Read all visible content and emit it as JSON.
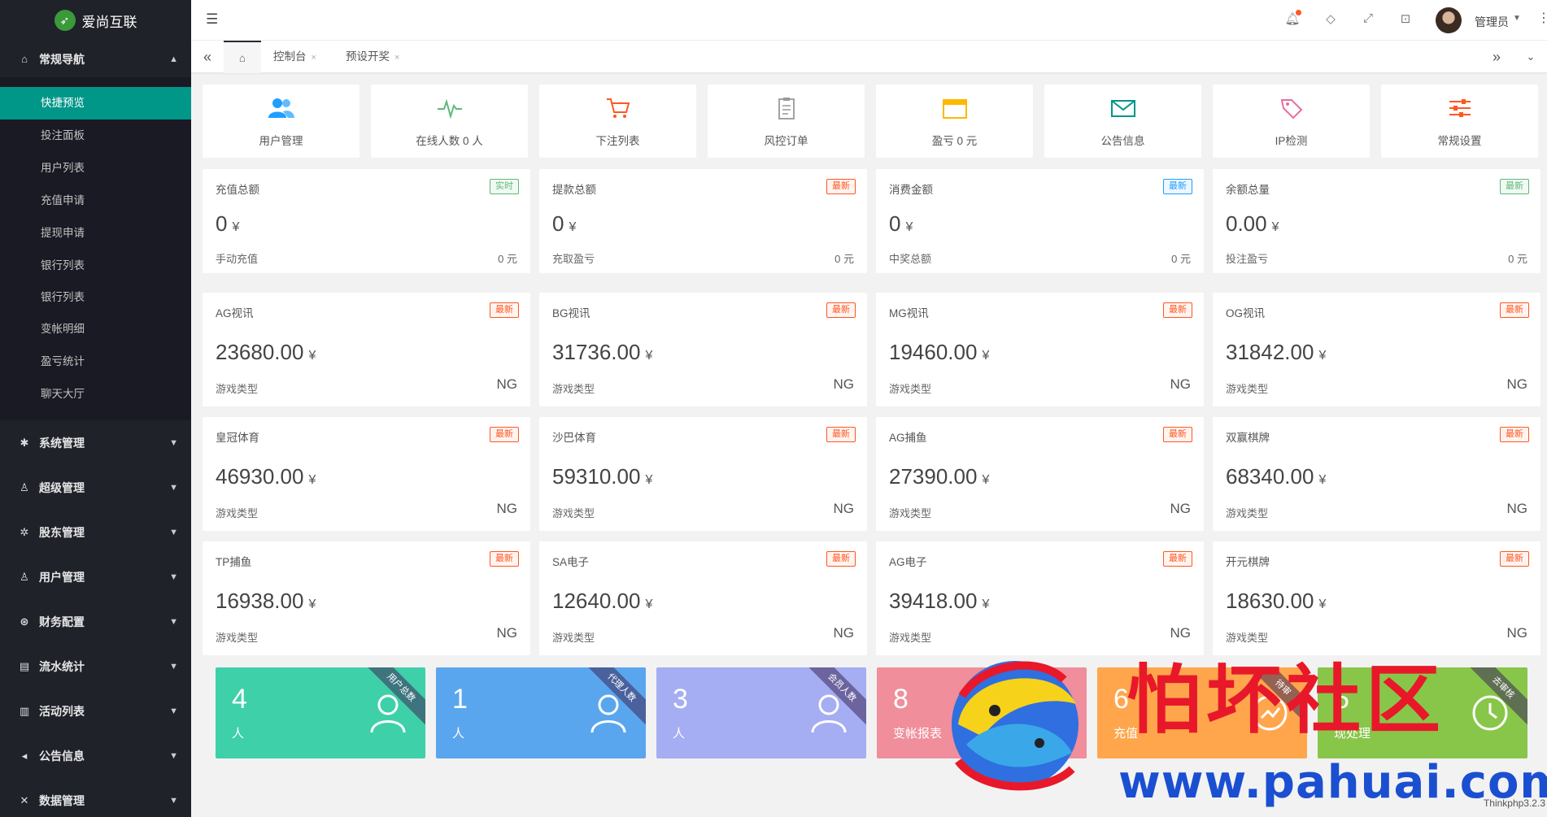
{
  "app": {
    "name": "爱尚互联",
    "version": "Thinkphp3.2.3",
    "colors": {
      "sidebar": "#20222a",
      "accent": "#009688"
    }
  },
  "sidebar": {
    "groups": [
      {
        "label": "常规导航",
        "icon": "home-icon",
        "expanded": true,
        "items": [
          "快捷预览",
          "投注面板",
          "用户列表",
          "充值申请",
          "提现申请",
          "银行列表",
          "银行列表",
          "变帐明细",
          "盈亏统计",
          "聊天大厅"
        ]
      },
      {
        "label": "系统管理",
        "icon": "gear-icon"
      },
      {
        "label": "超级管理",
        "icon": "user-icon"
      },
      {
        "label": "股东管理",
        "icon": "settings-icon"
      },
      {
        "label": "用户管理",
        "icon": "users-icon"
      },
      {
        "label": "财务配置",
        "icon": "yen-icon"
      },
      {
        "label": "流水统计",
        "icon": "list-icon"
      },
      {
        "label": "活动列表",
        "icon": "gift-icon"
      },
      {
        "label": "公告信息",
        "icon": "speaker-icon"
      },
      {
        "label": "数据管理",
        "icon": "tools-icon"
      }
    ]
  },
  "header": {
    "user_name": "管理员"
  },
  "tabs": {
    "items": [
      {
        "label": "控制台",
        "close": "×"
      },
      {
        "label": "预设开奖",
        "close": "×"
      }
    ]
  },
  "quick_links": [
    {
      "label": "用户管理",
      "icon": "users-icon",
      "color": "#1E9FFF"
    },
    {
      "label": "在线人数 0 人",
      "icon": "pulse-icon",
      "color": "#5FB878"
    },
    {
      "label": "下注列表",
      "icon": "cart-icon",
      "color": "#FF5722"
    },
    {
      "label": "风控订单",
      "icon": "clipboard-icon",
      "color": "#999999"
    },
    {
      "label": "盈亏 0 元",
      "icon": "wallet-icon",
      "color": "#FFB800"
    },
    {
      "label": "公告信息",
      "icon": "mail-icon",
      "color": "#009688"
    },
    {
      "label": "IP检测",
      "icon": "tag-icon",
      "color": "#E86CA3"
    },
    {
      "label": "常规设置",
      "icon": "sliders-icon",
      "color": "#FF5722"
    }
  ],
  "summary_cards": [
    {
      "title": "充值总额",
      "badge": "实时",
      "badge_type": "green",
      "value": "0",
      "currency": "¥",
      "foot": "手动充值",
      "right": "0 元"
    },
    {
      "title": "提款总额",
      "badge": "最新",
      "badge_type": "red",
      "value": "0",
      "currency": "¥",
      "foot": "充取盈亏",
      "right": "0 元"
    },
    {
      "title": "消费金额",
      "badge": "最新",
      "badge_type": "blue",
      "value": "0",
      "currency": "¥",
      "foot": "中奖总额",
      "right": "0 元"
    },
    {
      "title": "余额总量",
      "badge": "最新",
      "badge_type": "green",
      "value": "0.00",
      "currency": "¥",
      "foot": "投注盈亏",
      "right": "0 元"
    }
  ],
  "game_cards": [
    {
      "title": "AG视讯",
      "badge": "最新",
      "value": "23680.00",
      "currency": "¥",
      "foot": "游戏类型",
      "right": "NG"
    },
    {
      "title": "BG视讯",
      "badge": "最新",
      "value": "31736.00",
      "currency": "¥",
      "foot": "游戏类型",
      "right": "NG"
    },
    {
      "title": "MG视讯",
      "badge": "最新",
      "value": "19460.00",
      "currency": "¥",
      "foot": "游戏类型",
      "right": "NG"
    },
    {
      "title": "OG视讯",
      "badge": "最新",
      "value": "31842.00",
      "currency": "¥",
      "foot": "游戏类型",
      "right": "NG"
    },
    {
      "title": "皇冠体育",
      "badge": "最新",
      "value": "46930.00",
      "currency": "¥",
      "foot": "游戏类型",
      "right": "NG"
    },
    {
      "title": "沙巴体育",
      "badge": "最新",
      "value": "59310.00",
      "currency": "¥",
      "foot": "游戏类型",
      "right": "NG"
    },
    {
      "title": "AG捕鱼",
      "badge": "最新",
      "value": "27390.00",
      "currency": "¥",
      "foot": "游戏类型",
      "right": "NG"
    },
    {
      "title": "双赢棋牌",
      "badge": "最新",
      "value": "68340.00",
      "currency": "¥",
      "foot": "游戏类型",
      "right": "NG"
    },
    {
      "title": "TP捕鱼",
      "badge": "最新",
      "value": "16938.00",
      "currency": "¥",
      "foot": "游戏类型",
      "right": "NG"
    },
    {
      "title": "SA电子",
      "badge": "最新",
      "value": "12640.00",
      "currency": "¥",
      "foot": "游戏类型",
      "right": "NG"
    },
    {
      "title": "AG电子",
      "badge": "最新",
      "value": "39418.00",
      "currency": "¥",
      "foot": "游戏类型",
      "right": "NG"
    },
    {
      "title": "开元棋牌",
      "badge": "最新",
      "value": "18630.00",
      "currency": "¥",
      "foot": "游戏类型",
      "right": "NG"
    }
  ],
  "stat_tiles": [
    {
      "number": "4",
      "unit": "人",
      "ribbon": "用户总数",
      "color": "#3ED0A9",
      "icon": "user-icon"
    },
    {
      "number": "1",
      "unit": "人",
      "ribbon": "代理人数",
      "color": "#5AA6EE",
      "icon": "user-icon"
    },
    {
      "number": "3",
      "unit": "人",
      "ribbon": "会员人数",
      "color": "#A5ADF3",
      "icon": "user-icon"
    },
    {
      "number": "8",
      "unit": "变帐报表",
      "ribbon": "",
      "color": "#F08E9B",
      "icon": "table-icon"
    },
    {
      "number": "6",
      "unit": "充值",
      "ribbon": "待审",
      "color": "#FFA64D",
      "icon": "chart-icon"
    },
    {
      "number": "5",
      "unit": "现处理",
      "ribbon": "去审核",
      "color": "#88C64A",
      "icon": "clock-icon"
    }
  ],
  "watermark": {
    "title": "怕坏社区",
    "url": "www.pahuai.com"
  }
}
